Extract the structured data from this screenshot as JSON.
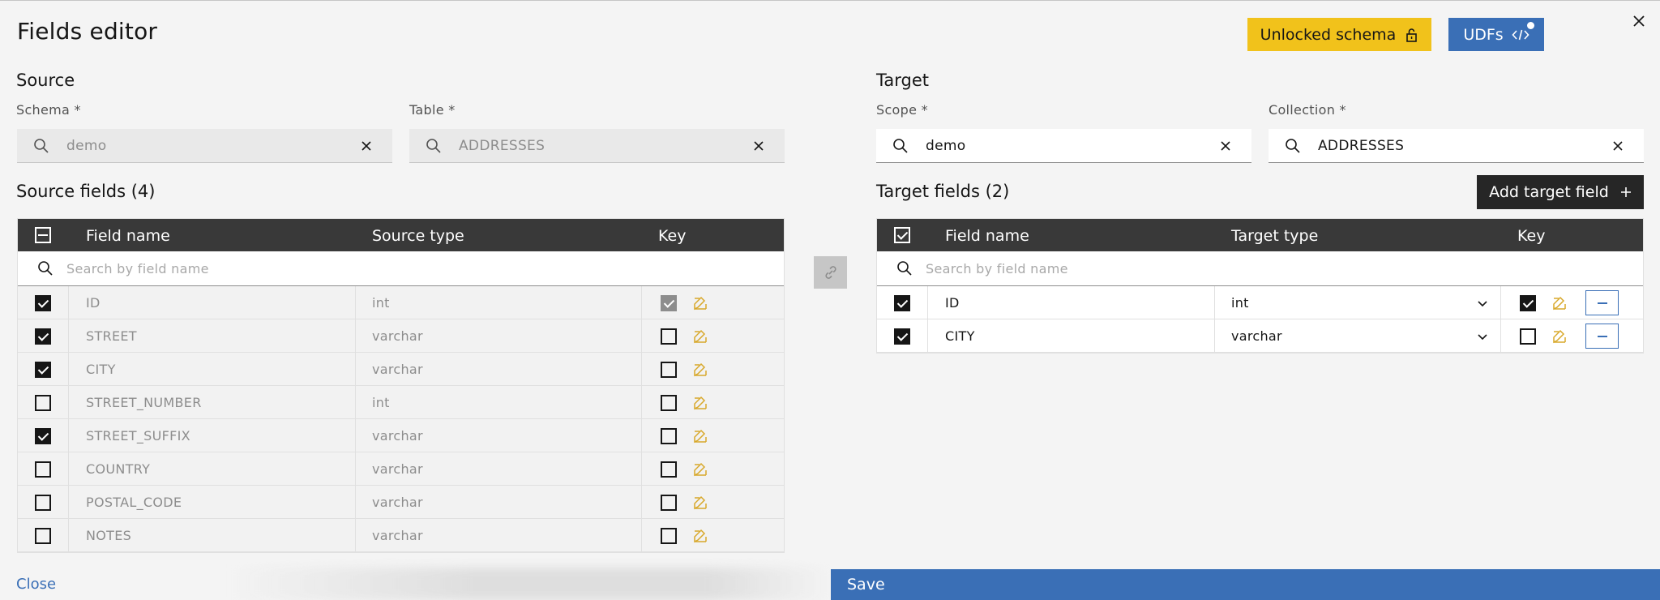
{
  "header": {
    "title": "Fields editor",
    "unlock_label": "Unlocked schema",
    "udf_label": "UDFs"
  },
  "source": {
    "heading": "Source",
    "schema_label": "Schema *",
    "schema_value": "demo",
    "table_label": "Table *",
    "table_value": "ADDRESSES",
    "fields_heading": "Source fields (4)",
    "columns": {
      "name": "Field name",
      "type": "Source type",
      "key": "Key"
    },
    "search_placeholder": "Search by field name",
    "rows": [
      {
        "name": "ID",
        "type": "int",
        "selected": true,
        "key": true
      },
      {
        "name": "STREET",
        "type": "varchar",
        "selected": true,
        "key": false
      },
      {
        "name": "CITY",
        "type": "varchar",
        "selected": true,
        "key": false
      },
      {
        "name": "STREET_NUMBER",
        "type": "int",
        "selected": false,
        "key": false
      },
      {
        "name": "STREET_SUFFIX",
        "type": "varchar",
        "selected": true,
        "key": false
      },
      {
        "name": "COUNTRY",
        "type": "varchar",
        "selected": false,
        "key": false
      },
      {
        "name": "POSTAL_CODE",
        "type": "varchar",
        "selected": false,
        "key": false
      },
      {
        "name": "NOTES",
        "type": "varchar",
        "selected": false,
        "key": false
      }
    ]
  },
  "target": {
    "heading": "Target",
    "scope_label": "Scope *",
    "scope_value": "demo",
    "collection_label": "Collection *",
    "collection_value": "ADDRESSES",
    "fields_heading": "Target fields (2)",
    "add_label": "Add target field",
    "columns": {
      "name": "Field name",
      "type": "Target type",
      "key": "Key"
    },
    "search_placeholder": "Search by field name",
    "rows": [
      {
        "name": "ID",
        "type": "int",
        "selected": true,
        "key": true
      },
      {
        "name": "CITY",
        "type": "varchar",
        "selected": true,
        "key": false
      }
    ]
  },
  "footer": {
    "close_label": "Close",
    "save_label": "Save"
  },
  "colors": {
    "accent_blue": "#3a6fb6",
    "warning_yellow": "#f1c21b",
    "edit_icon": "#d8a82a",
    "table_header": "#393939"
  },
  "icons": {
    "search": "search-icon",
    "clear": "close-icon",
    "lock": "unlock-icon",
    "code": "code-icon",
    "edit": "edit-icon",
    "link": "link-icon",
    "chevron": "chevron-down-icon"
  }
}
